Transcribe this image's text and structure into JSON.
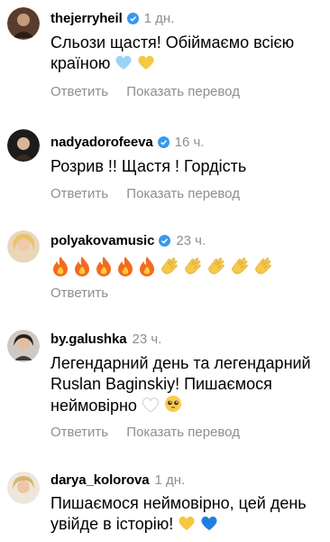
{
  "comments": [
    {
      "username": "thejerryheil",
      "time": "1 дн.",
      "text": "Сльози щастя! Обіймаємо всією країною",
      "reply": "Ответить",
      "translate": "Показать перевод",
      "emojis": [
        "light-blue-heart",
        "yellow-heart"
      ]
    },
    {
      "username": "nadyadorofeeva",
      "time": "16 ч.",
      "text": "Розрив !! Щастя ! Гордість",
      "reply": "Ответить",
      "translate": "Показать перевод"
    },
    {
      "username": "polyakovamusic",
      "time": "23 ч.",
      "emojis": [
        "fire",
        "fire",
        "fire",
        "fire",
        "fire",
        "clap",
        "clap",
        "clap",
        "clap",
        "clap"
      ],
      "reply": "Ответить"
    },
    {
      "username": "by.galushka",
      "time": "23 ч.",
      "text": "Легендарний день та легендарний Ruslan Baginskiy! Пишаємося неймовірно",
      "reply": "Ответить",
      "translate": "Показать перевод",
      "emojis": [
        "white-heart",
        "pleading-face"
      ]
    },
    {
      "username": "darya_kolorova",
      "time": "1 дн.",
      "text": "Пишаємося неймовірно, цей день увійде в історію!",
      "emojis": [
        "yellow-heart",
        "blue-heart"
      ]
    }
  ],
  "colors": {
    "verified": "#3897f0",
    "secondary_text": "#8e8e8e",
    "light_blue_heart": "#9ad4f5",
    "yellow_heart": "#f5c842",
    "blue_heart": "#1f7fe0"
  }
}
